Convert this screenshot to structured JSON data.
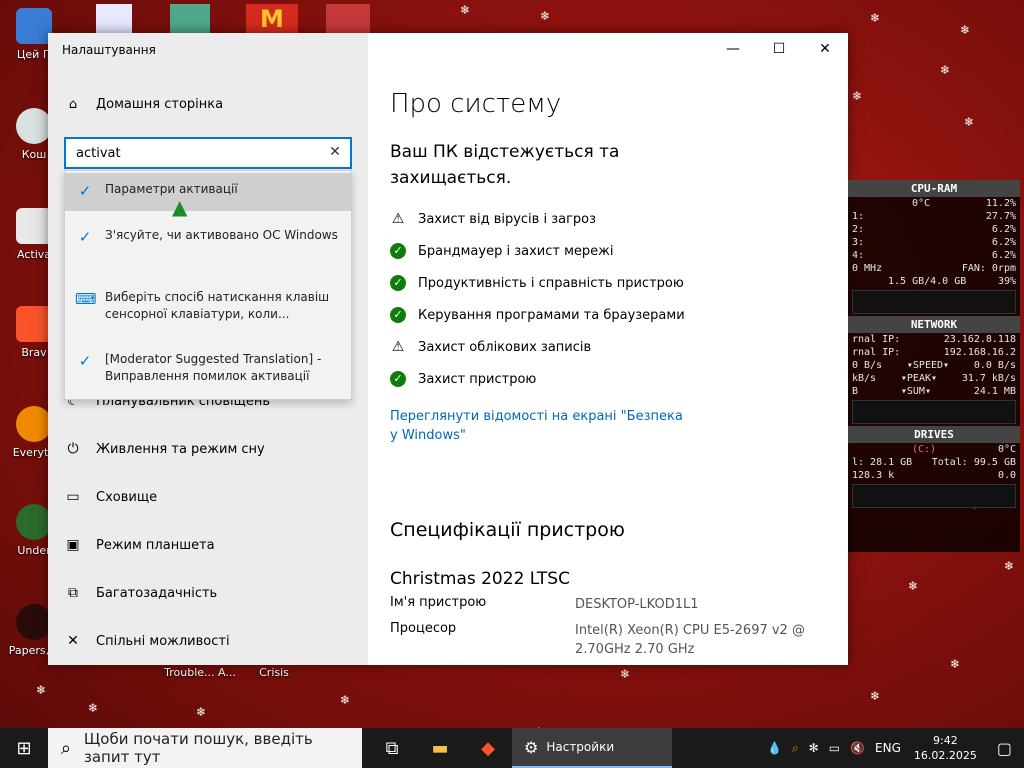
{
  "window": {
    "title": "Налаштування",
    "minimize": "—",
    "maximize": "☐",
    "close": "✕"
  },
  "sidebar": {
    "home": "Домашня сторінка",
    "search_value": "activat",
    "search_clear": "✕",
    "suggestions": [
      {
        "label": "Параметри активації"
      },
      {
        "label": "З'ясуйте, чи активовано ОС Windows"
      },
      {
        "label": "Виберіть спосіб натискання клавіш сенсорної клавіатури, коли..."
      },
      {
        "label": "[Moderator Suggested Translation] - Виправлення помилок активації"
      }
    ],
    "nav": [
      {
        "label": "Планувальник сповіщень"
      },
      {
        "label": "Живлення та режим сну"
      },
      {
        "label": "Сховище"
      },
      {
        "label": "Режим планшета"
      },
      {
        "label": "Багатозадачність"
      },
      {
        "label": "Спільні можливості"
      }
    ]
  },
  "main": {
    "title": "Про систему",
    "subtitle": "Ваш ПК відстежується та захищається.",
    "security": [
      {
        "label": "Захист від вірусів і загроз",
        "status": "warning"
      },
      {
        "label": "Брандмауер і захист мережі",
        "status": "ok"
      },
      {
        "label": "Продуктивність і справність пристрою",
        "status": "ok"
      },
      {
        "label": "Керування програмами та браузерами",
        "status": "ok"
      },
      {
        "label": "Захист облікових записів",
        "status": "warning"
      },
      {
        "label": "Захист пристрою",
        "status": "ok"
      }
    ],
    "security_link": "Переглянути відомості на екрані \"Безпека у Windows\"",
    "spec_heading": "Специфікації пристрою",
    "edition": "Christmas 2022 LTSC",
    "specs": [
      {
        "key": "Ім'я пристрою",
        "value": "DESKTOP-LKOD1L1"
      },
      {
        "key": "Процесор",
        "value": "Intel(R) Xeon(R) CPU E5-2697 v2 @ 2.70GHz   2.70 GHz"
      }
    ]
  },
  "desktop_icons": [
    {
      "label": "Цей П"
    },
    {
      "label": "Кош"
    },
    {
      "label": "Activa"
    },
    {
      "label": "Brav"
    },
    {
      "label": "Everyth"
    },
    {
      "label": "Under"
    },
    {
      "label": "Papers, P"
    },
    {
      "label": "Trouble... A..."
    },
    {
      "label": "Crisis"
    }
  ],
  "gadget": {
    "cpu_title": "CPU-RAM",
    "cpu_temp": "0°C",
    "cpu_total": "11.2%",
    "cores": [
      {
        "label": "1:",
        "value": "27.7%"
      },
      {
        "label": "2:",
        "value": "6.2%"
      },
      {
        "label": "3:",
        "value": "6.2%"
      },
      {
        "label": "4:",
        "value": "6.2%"
      }
    ],
    "freq": "0 MHz",
    "fan": "FAN: 0rpm",
    "ram": "1.5 GB/4.0 GB",
    "ram_pct": "39%",
    "net_title": "NETWORK",
    "ext_ip_label": "rnal IP:",
    "ext_ip": "23.162.8.118",
    "int_ip_label": "rnal IP:",
    "int_ip": "192.168.16.2",
    "speed_left": "0 B/s",
    "speed_label": "▾SPEED▾",
    "speed_right": "0.0 B/s",
    "peak_left": "kB/s",
    "peak_label": "▾PEAK▾",
    "peak_right": "31.7 kB/s",
    "sum_left": "B",
    "sum_label": "▾SUM▾",
    "sum_right": "24.1 MB",
    "drives_title": "DRIVES",
    "drive_c": "(C:)",
    "drive_temp": "0°C",
    "drive_used": "l: 28.1 GB",
    "drive_total": "Total: 99.5 GB",
    "drive_rw_left": "128.3 k",
    "drive_rw_right": "0.0"
  },
  "taskbar": {
    "search_placeholder": "Щоби почати пошук, введіть запит тут",
    "active_app": "Настройки",
    "lang": "ENG",
    "time": "9:42",
    "date": "16.02.2025"
  }
}
